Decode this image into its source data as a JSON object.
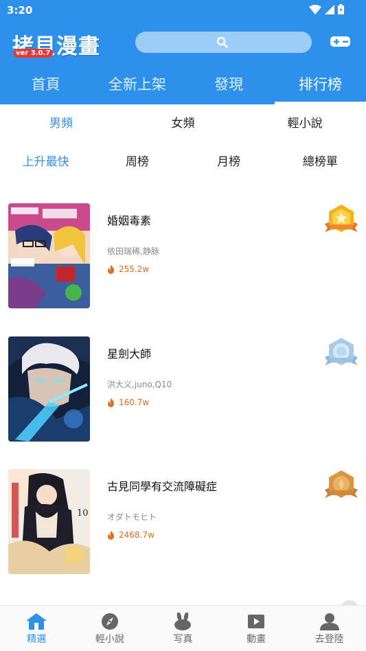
{
  "status_bar": {
    "time": "3:20"
  },
  "header": {
    "logo_text": "拷貝漫畫",
    "logo_version": "ver 3.0.7",
    "search_icon": "search-icon",
    "right_icon": "gamepad-icon",
    "colors": {
      "primary": "#2d91ec",
      "search_bg": "#9ccdf7",
      "version_badge": "#e53935"
    }
  },
  "main_tabs": [
    {
      "label": "首頁",
      "active": false
    },
    {
      "label": "全新上架",
      "active": false
    },
    {
      "label": "發現",
      "active": false
    },
    {
      "label": "排行榜",
      "active": true
    }
  ],
  "category_tabs": [
    {
      "label": "男頻",
      "active": true
    },
    {
      "label": "女頻",
      "active": false
    },
    {
      "label": "輕小說",
      "active": false
    }
  ],
  "ranking_tabs": [
    {
      "label": "上升最快",
      "active": true
    },
    {
      "label": "周榜",
      "active": false
    },
    {
      "label": "月榜",
      "active": false
    },
    {
      "label": "總榜單",
      "active": false
    }
  ],
  "comics": [
    {
      "rank": 1,
      "title": "婚姻毒素",
      "authors": "依田瑞稀,静脉",
      "heat": "255.2w",
      "badge": "gold-medal-icon"
    },
    {
      "rank": 2,
      "title": "星劍大師",
      "authors": "洪大义,juno,Q10",
      "heat": "160.7w",
      "badge": "silver-medal-icon"
    },
    {
      "rank": 3,
      "title": "古見同學有交流障礙症",
      "authors": "オダトモヒト",
      "heat": "2468.7w",
      "badge": "bronze-medal-icon"
    }
  ],
  "bottom_nav": [
    {
      "label": "精選",
      "icon": "home-icon",
      "active": true
    },
    {
      "label": "輕小說",
      "icon": "compass-icon",
      "active": false
    },
    {
      "label": "写真",
      "icon": "bunny-icon",
      "active": false
    },
    {
      "label": "動畫",
      "icon": "play-icon",
      "active": false
    },
    {
      "label": "去登陸",
      "icon": "user-icon",
      "active": false
    }
  ]
}
